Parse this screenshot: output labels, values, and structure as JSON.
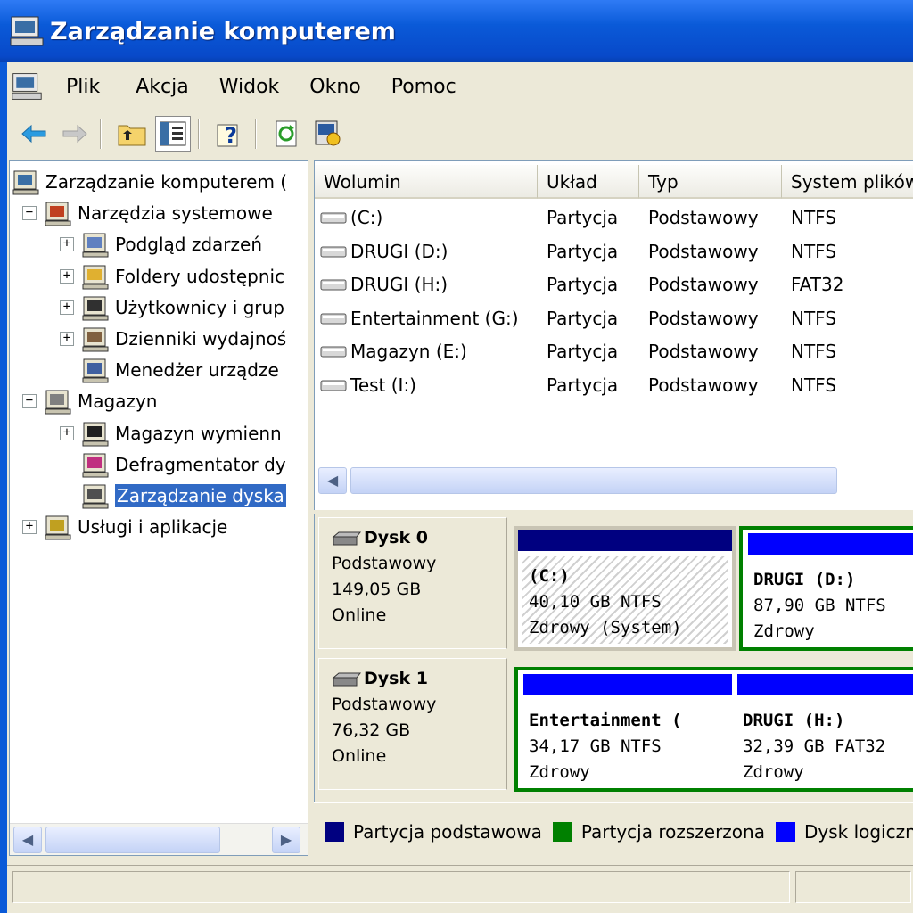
{
  "window": {
    "title": "Zarządzanie komputerem"
  },
  "menu": {
    "items": [
      "Plik",
      "Akcja",
      "Widok",
      "Okno",
      "Pomoc"
    ]
  },
  "tree": {
    "nodes": [
      {
        "label": "Zarządzanie komputerem (",
        "level": 0,
        "expander": ""
      },
      {
        "label": "Narzędzia systemowe",
        "level": 1,
        "expander": "−"
      },
      {
        "label": "Podgląd zdarzeń",
        "level": 2,
        "expander": "+"
      },
      {
        "label": "Foldery udostępnic",
        "level": 2,
        "expander": "+"
      },
      {
        "label": "Użytkownicy i grup",
        "level": 2,
        "expander": "+"
      },
      {
        "label": "Dzienniki wydajnoś",
        "level": 2,
        "expander": "+"
      },
      {
        "label": "Menedżer urządze",
        "level": 2,
        "expander": ""
      },
      {
        "label": "Magazyn",
        "level": 1,
        "expander": "−"
      },
      {
        "label": "Magazyn wymienn",
        "level": 2,
        "expander": "+"
      },
      {
        "label": "Defragmentator dy",
        "level": 2,
        "expander": ""
      },
      {
        "label": "Zarządzanie dyska",
        "level": 2,
        "expander": "",
        "selected": true
      },
      {
        "label": "Usługi i aplikacje",
        "level": 1,
        "expander": "+"
      }
    ]
  },
  "volumes": {
    "columns": [
      "Wolumin",
      "Układ",
      "Typ",
      "System plików"
    ],
    "rows": [
      [
        "(C:)",
        "Partycja",
        "Podstawowy",
        "NTFS"
      ],
      [
        "DRUGI (D:)",
        "Partycja",
        "Podstawowy",
        "NTFS"
      ],
      [
        "DRUGI (H:)",
        "Partycja",
        "Podstawowy",
        "FAT32"
      ],
      [
        "Entertainment (G:)",
        "Partycja",
        "Podstawowy",
        "NTFS"
      ],
      [
        "Magazyn (E:)",
        "Partycja",
        "Podstawowy",
        "NTFS"
      ],
      [
        "Test (I:)",
        "Partycja",
        "Podstawowy",
        "NTFS"
      ]
    ]
  },
  "disks": [
    {
      "name": "Dysk 0",
      "type": "Podstawowy",
      "size": "149,05 GB",
      "status": "Online",
      "partitions": [
        {
          "name": "(C:)",
          "size": "40,10 GB NTFS",
          "health": "Zdrowy (System)"
        },
        {
          "name": "DRUGI  (D:)",
          "size": "87,90 GB NTFS",
          "health": "Zdrowy"
        }
      ]
    },
    {
      "name": "Dysk 1",
      "type": "Podstawowy",
      "size": "76,32 GB",
      "status": "Online",
      "partitions": [
        {
          "name": "Entertainment (",
          "size": "34,17 GB NTFS",
          "health": "Zdrowy"
        },
        {
          "name": "DRUGI  (H:)",
          "size": "32,39 GB FAT32",
          "health": "Zdrowy"
        }
      ]
    }
  ],
  "legend": [
    {
      "label": "Partycja podstawowa",
      "color": "#000080"
    },
    {
      "label": "Partycja rozszerzona",
      "color": "#008000"
    },
    {
      "label": "Dysk logiczny",
      "color": "#0000ff"
    }
  ],
  "colors": {
    "selection": "#316ac5",
    "extended_border": "#008000",
    "primary_bar": "#000080",
    "logical_bar": "#0000ff"
  }
}
